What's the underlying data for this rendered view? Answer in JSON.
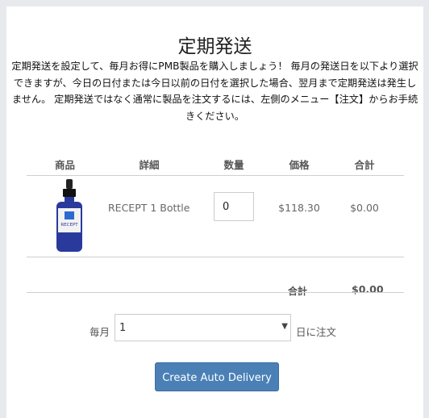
{
  "page": {
    "title": "定期発送",
    "description": "定期発送を設定して、毎月お得にPMB製品を購入しましょう！ 毎月の発送日を以下より選択できますが、今日の日付または今日以前の日付を選択した場合、翌月まで定期発送は発生しません。 定期発送ではなく通常に製品を注文するには、左側のメニュー【注文】からお手続きください。"
  },
  "table": {
    "headers": {
      "product": "商品",
      "details": "詳細",
      "quantity": "数量",
      "price": "価格",
      "total": "合計"
    },
    "rows": [
      {
        "product_image": "recept-bottle-image",
        "bottle_label": "RECEPT",
        "details": "RECEPT 1 Bottle",
        "quantity": "0",
        "price": "$118.30",
        "total": "$0.00"
      }
    ],
    "summary": {
      "label": "合計",
      "value": "$0.00"
    }
  },
  "schedule": {
    "prefix": "毎月",
    "selected_day": "1",
    "suffix": "日に注文",
    "arrow_icon": "▼"
  },
  "actions": {
    "create_label": "Create Auto Delivery"
  },
  "colors": {
    "button": "#4a80b6",
    "bottle_blue": "#2a3a9c",
    "background": "#e7e9ec"
  }
}
